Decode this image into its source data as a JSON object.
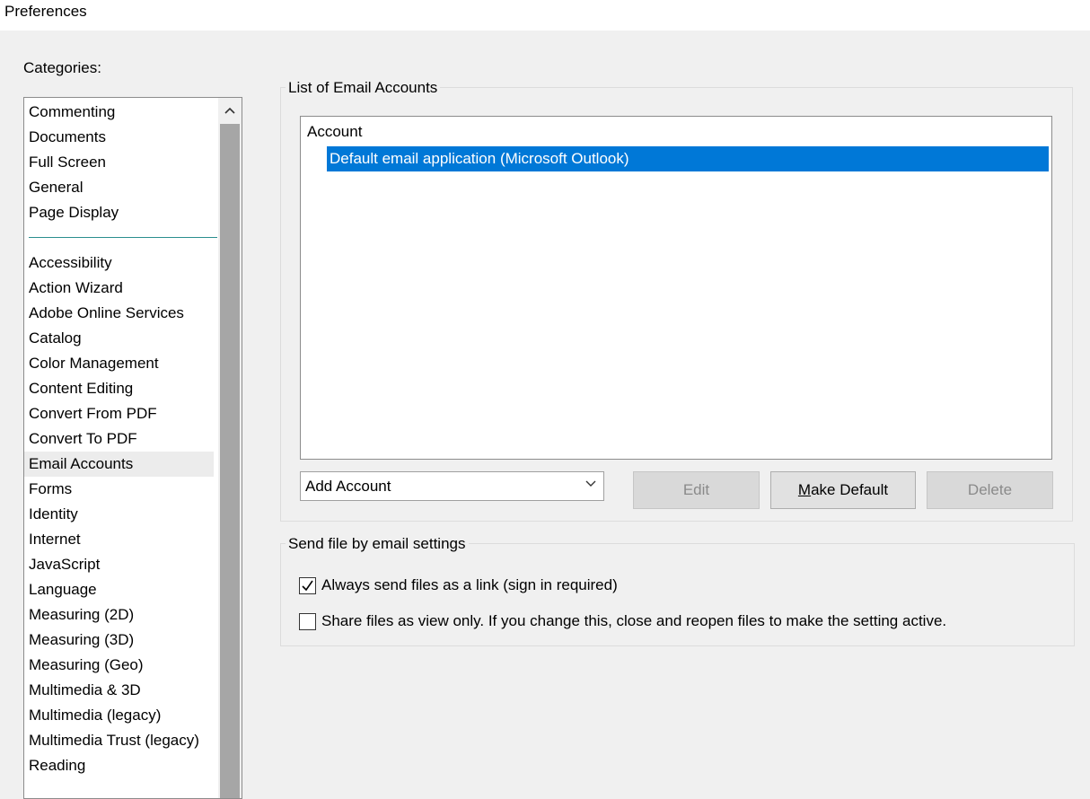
{
  "window": {
    "title": "Preferences"
  },
  "categories": {
    "label": "Categories:",
    "top_items": [
      "Commenting",
      "Documents",
      "Full Screen",
      "General",
      "Page Display"
    ],
    "items": [
      "Accessibility",
      "Action Wizard",
      "Adobe Online Services",
      "Catalog",
      "Color Management",
      "Content Editing",
      "Convert From PDF",
      "Convert To PDF",
      "Email Accounts",
      "Forms",
      "Identity",
      "Internet",
      "JavaScript",
      "Language",
      "Measuring (2D)",
      "Measuring (3D)",
      "Measuring (Geo)",
      "Multimedia & 3D",
      "Multimedia (legacy)",
      "Multimedia Trust (legacy)",
      "Reading"
    ],
    "selected": "Email Accounts",
    "scroll_up_icon": "chevron-up-icon"
  },
  "email_accounts": {
    "group_title": "List of Email Accounts",
    "column_header": "Account",
    "rows": [
      "Default email application (Microsoft Outlook)"
    ],
    "add_account": {
      "value": "Add Account",
      "icon": "chevron-down-icon"
    },
    "buttons": {
      "edit": "Edit",
      "make_default_mnemonic": "M",
      "make_default_rest": "ake Default",
      "delete": "Delete"
    }
  },
  "send_settings": {
    "group_title": "Send file by email settings",
    "always_link": {
      "label": "Always send files as a link (sign in required)",
      "checked": true
    },
    "view_only": {
      "label": "Share files as view only. If you change this, close and reopen files to make the setting active.",
      "checked": false
    }
  },
  "colors": {
    "selection": "#0078d7",
    "separator": "#2a8f8f"
  }
}
